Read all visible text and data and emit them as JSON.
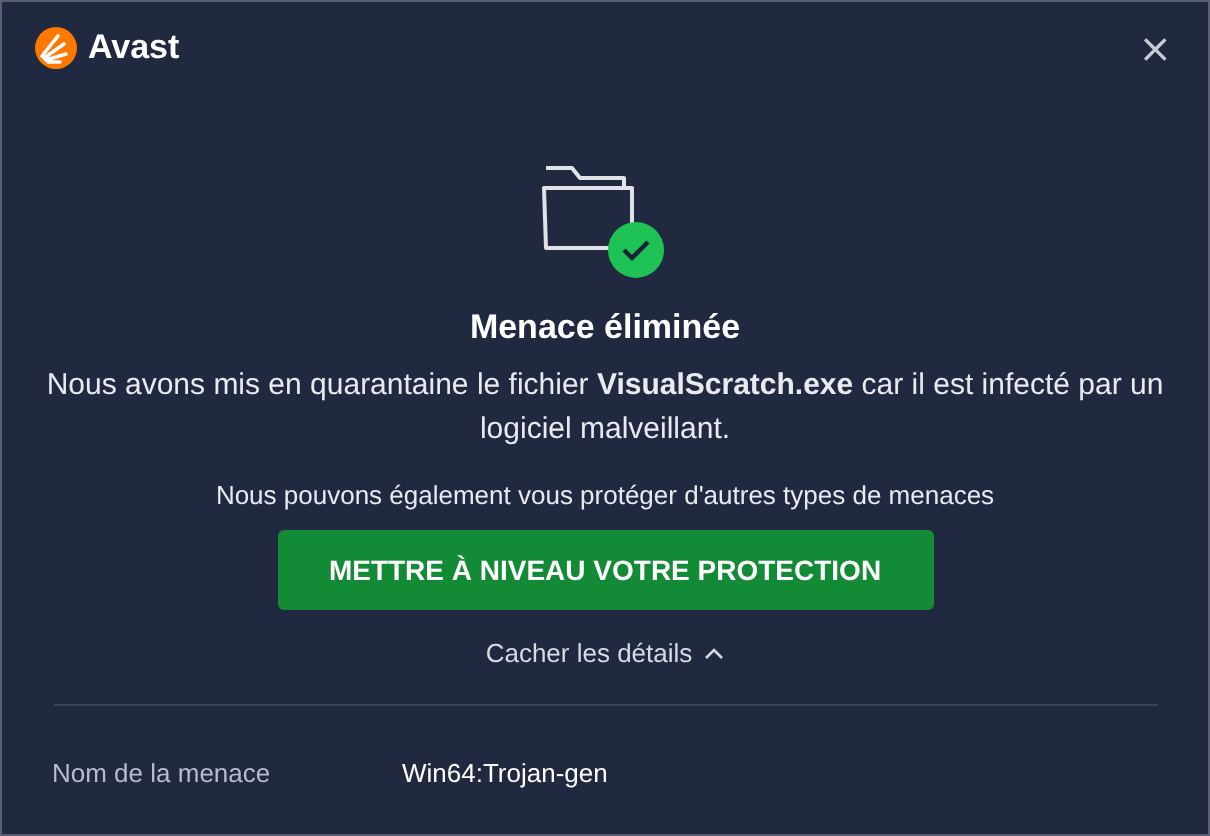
{
  "header": {
    "brand": "Avast",
    "close": "×"
  },
  "status": {
    "title": "Menace éliminée",
    "message": "Nous avons mis en quarantaine le fichier **VisualScratch.exe** car il est infecté par un logiciel malveillant."
  },
  "upsell": {
    "text": "Nous pouvons également vous protéger d'autres types de menaces",
    "button": "METTRE À NIVEAU VOTRE PROTECTION"
  },
  "details": {
    "toggle": "Cacher les détails",
    "expanded": true,
    "rows": [
      {
        "label": "Nom de la menace",
        "value": "Win64:Trojan-gen"
      }
    ]
  }
}
